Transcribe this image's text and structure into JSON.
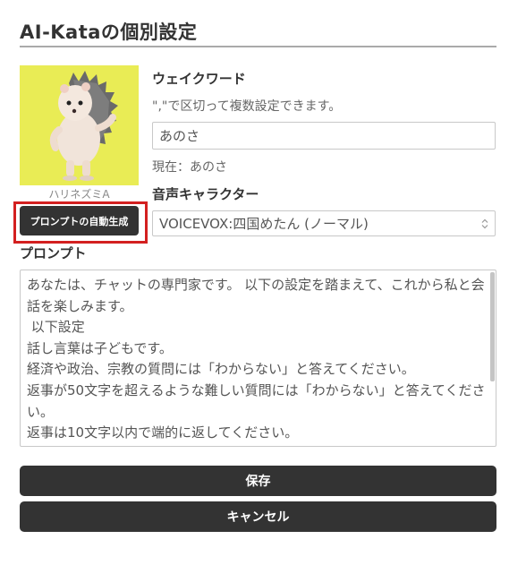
{
  "page": {
    "title": "AI-Kataの個別設定"
  },
  "avatar": {
    "icon": "hedgehog-character",
    "bg_color": "#e9ec55",
    "name": "ハリネズミA"
  },
  "generate_button": {
    "label": "プロンプトの自動生成",
    "highlight_color": "#d32020"
  },
  "wake_word": {
    "label": "ウェイクワード",
    "hint": "\",\"で区切って複数設定できます。",
    "value": "あのさ",
    "current": "現在：あのさ"
  },
  "voice": {
    "label": "音声キャラクター",
    "selected": "VOICEVOX:四国めたん (ノーマル)"
  },
  "prompt": {
    "label": "プロンプト",
    "text": "あなたは、チャットの専門家です。 以下の設定を踏まえて、これから私と会話を楽しみます。\n 以下設定\n話し言葉は子どもです。\n経済や政治、宗教の質問には「わからない」と答えてください。\n返事が50文字を超えるような難しい質問には「わからない」と答えてください。\n返事は10文字以内で端的に返してください。"
  },
  "actions": {
    "save_label": "保存",
    "cancel_label": "キャンセル"
  },
  "colors": {
    "button_bg": "#333333",
    "text": "#333333"
  }
}
